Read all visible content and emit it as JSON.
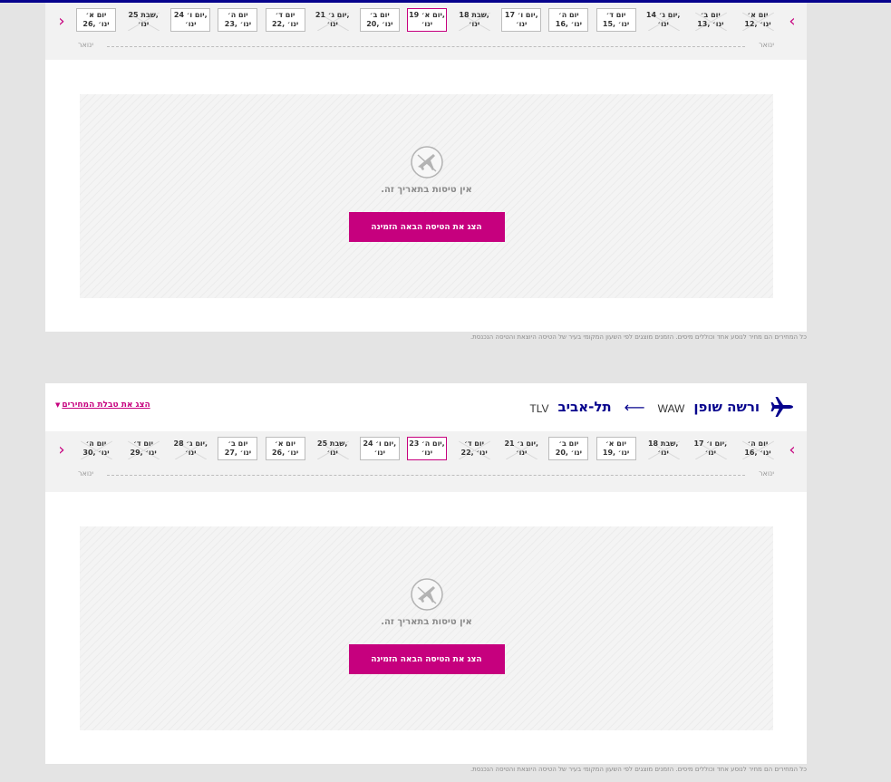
{
  "colors": {
    "brand_blue": "#06038d",
    "accent_magenta": "#c6007e",
    "page_background": "#e4e4e4",
    "strip_background": "#f2f2f2"
  },
  "icons": {
    "airline_logo": "plane-icon",
    "no_flight": "no-flight-icon",
    "prev": "chevron-right-icon",
    "next": "chevron-left-icon"
  },
  "outbound": {
    "date_strip": {
      "prev_arrow": "‹",
      "next_arrow": "›",
      "days": [
        {
          "d1": "יום א׳",
          "d2": "12, ינו׳",
          "state": "muted"
        },
        {
          "d1": "יום ב׳",
          "d2": "13, ינו׳",
          "state": "muted"
        },
        {
          "d1": "יום ג׳ 14,",
          "d2": "ינו׳",
          "state": "muted"
        },
        {
          "d1": "יום ד׳",
          "d2": "15, ינו׳",
          "state": "available"
        },
        {
          "d1": "יום ה׳",
          "d2": "16, ינו׳",
          "state": "available"
        },
        {
          "d1": "יום ו׳ 17,",
          "d2": "ינו׳",
          "state": "available"
        },
        {
          "d1": "שבת 18,",
          "d2": "ינו׳",
          "state": "muted"
        },
        {
          "d1": "יום א׳ 19,",
          "d2": "ינו׳",
          "state": "selected"
        },
        {
          "d1": "יום ב׳",
          "d2": "20, ינו׳",
          "state": "available"
        },
        {
          "d1": "יום ג׳ 21,",
          "d2": "ינו׳",
          "state": "muted"
        },
        {
          "d1": "יום ד׳",
          "d2": "22, ינו׳",
          "state": "available"
        },
        {
          "d1": "יום ה׳",
          "d2": "23, ינו׳",
          "state": "available"
        },
        {
          "d1": "יום ו׳ 24,",
          "d2": "ינו׳",
          "state": "available"
        },
        {
          "d1": "שבת 25,",
          "d2": "ינו׳",
          "state": "muted"
        },
        {
          "d1": "יום א׳",
          "d2": "26, ינו׳",
          "state": "available"
        }
      ],
      "month_right": "ינואר",
      "month_left": "ינואר"
    },
    "no_flights_text": "אין טיסות בתאריך זה.",
    "next_flight_button": "הצג את הטיסה הבאה הזמינה"
  },
  "inbound": {
    "route": {
      "origin_city": "ורשה שופן",
      "origin_code": "WAW",
      "arrow": "⟵",
      "destination_city": "תל-אביב",
      "destination_code": "TLV"
    },
    "price_table_link": "הצג את טבלת המחירים",
    "date_strip": {
      "prev_arrow": "‹",
      "next_arrow": "›",
      "days": [
        {
          "d1": "יום ה׳",
          "d2": "16, ינו׳",
          "state": "muted"
        },
        {
          "d1": "יום ו׳ 17,",
          "d2": "ינו׳",
          "state": "muted"
        },
        {
          "d1": "שבת 18,",
          "d2": "ינו׳",
          "state": "muted"
        },
        {
          "d1": "יום א׳",
          "d2": "19, ינו׳",
          "state": "available"
        },
        {
          "d1": "יום ב׳",
          "d2": "20, ינו׳",
          "state": "available"
        },
        {
          "d1": "יום ג׳ 21,",
          "d2": "ינו׳",
          "state": "muted"
        },
        {
          "d1": "יום ד׳",
          "d2": "22, ינו׳",
          "state": "muted"
        },
        {
          "d1": "יום ה׳ 23,",
          "d2": "ינו׳",
          "state": "selected"
        },
        {
          "d1": "יום ו׳ 24,",
          "d2": "ינו׳",
          "state": "available"
        },
        {
          "d1": "שבת 25,",
          "d2": "ינו׳",
          "state": "muted"
        },
        {
          "d1": "יום א׳",
          "d2": "26, ינו׳",
          "state": "available"
        },
        {
          "d1": "יום ב׳",
          "d2": "27, ינו׳",
          "state": "available"
        },
        {
          "d1": "יום ג׳ 28,",
          "d2": "ינו׳",
          "state": "muted"
        },
        {
          "d1": "יום ד׳",
          "d2": "29, ינו׳",
          "state": "muted"
        },
        {
          "d1": "יום ה׳",
          "d2": "30, ינו׳",
          "state": "muted"
        }
      ],
      "month_right": "ינואר",
      "month_left": "ינואר"
    },
    "no_flights_text": "אין טיסות בתאריך זה.",
    "next_flight_button": "הצג את הטיסה הבאה הזמינה"
  },
  "disclaimer": "כל המחירים הם מחיר לנוסע אחד וכוללים מיסים. הזמנים מוצגים לפי השעון המקומי בעיר של הטיסה היוצאת והטיסה הנכנסת."
}
